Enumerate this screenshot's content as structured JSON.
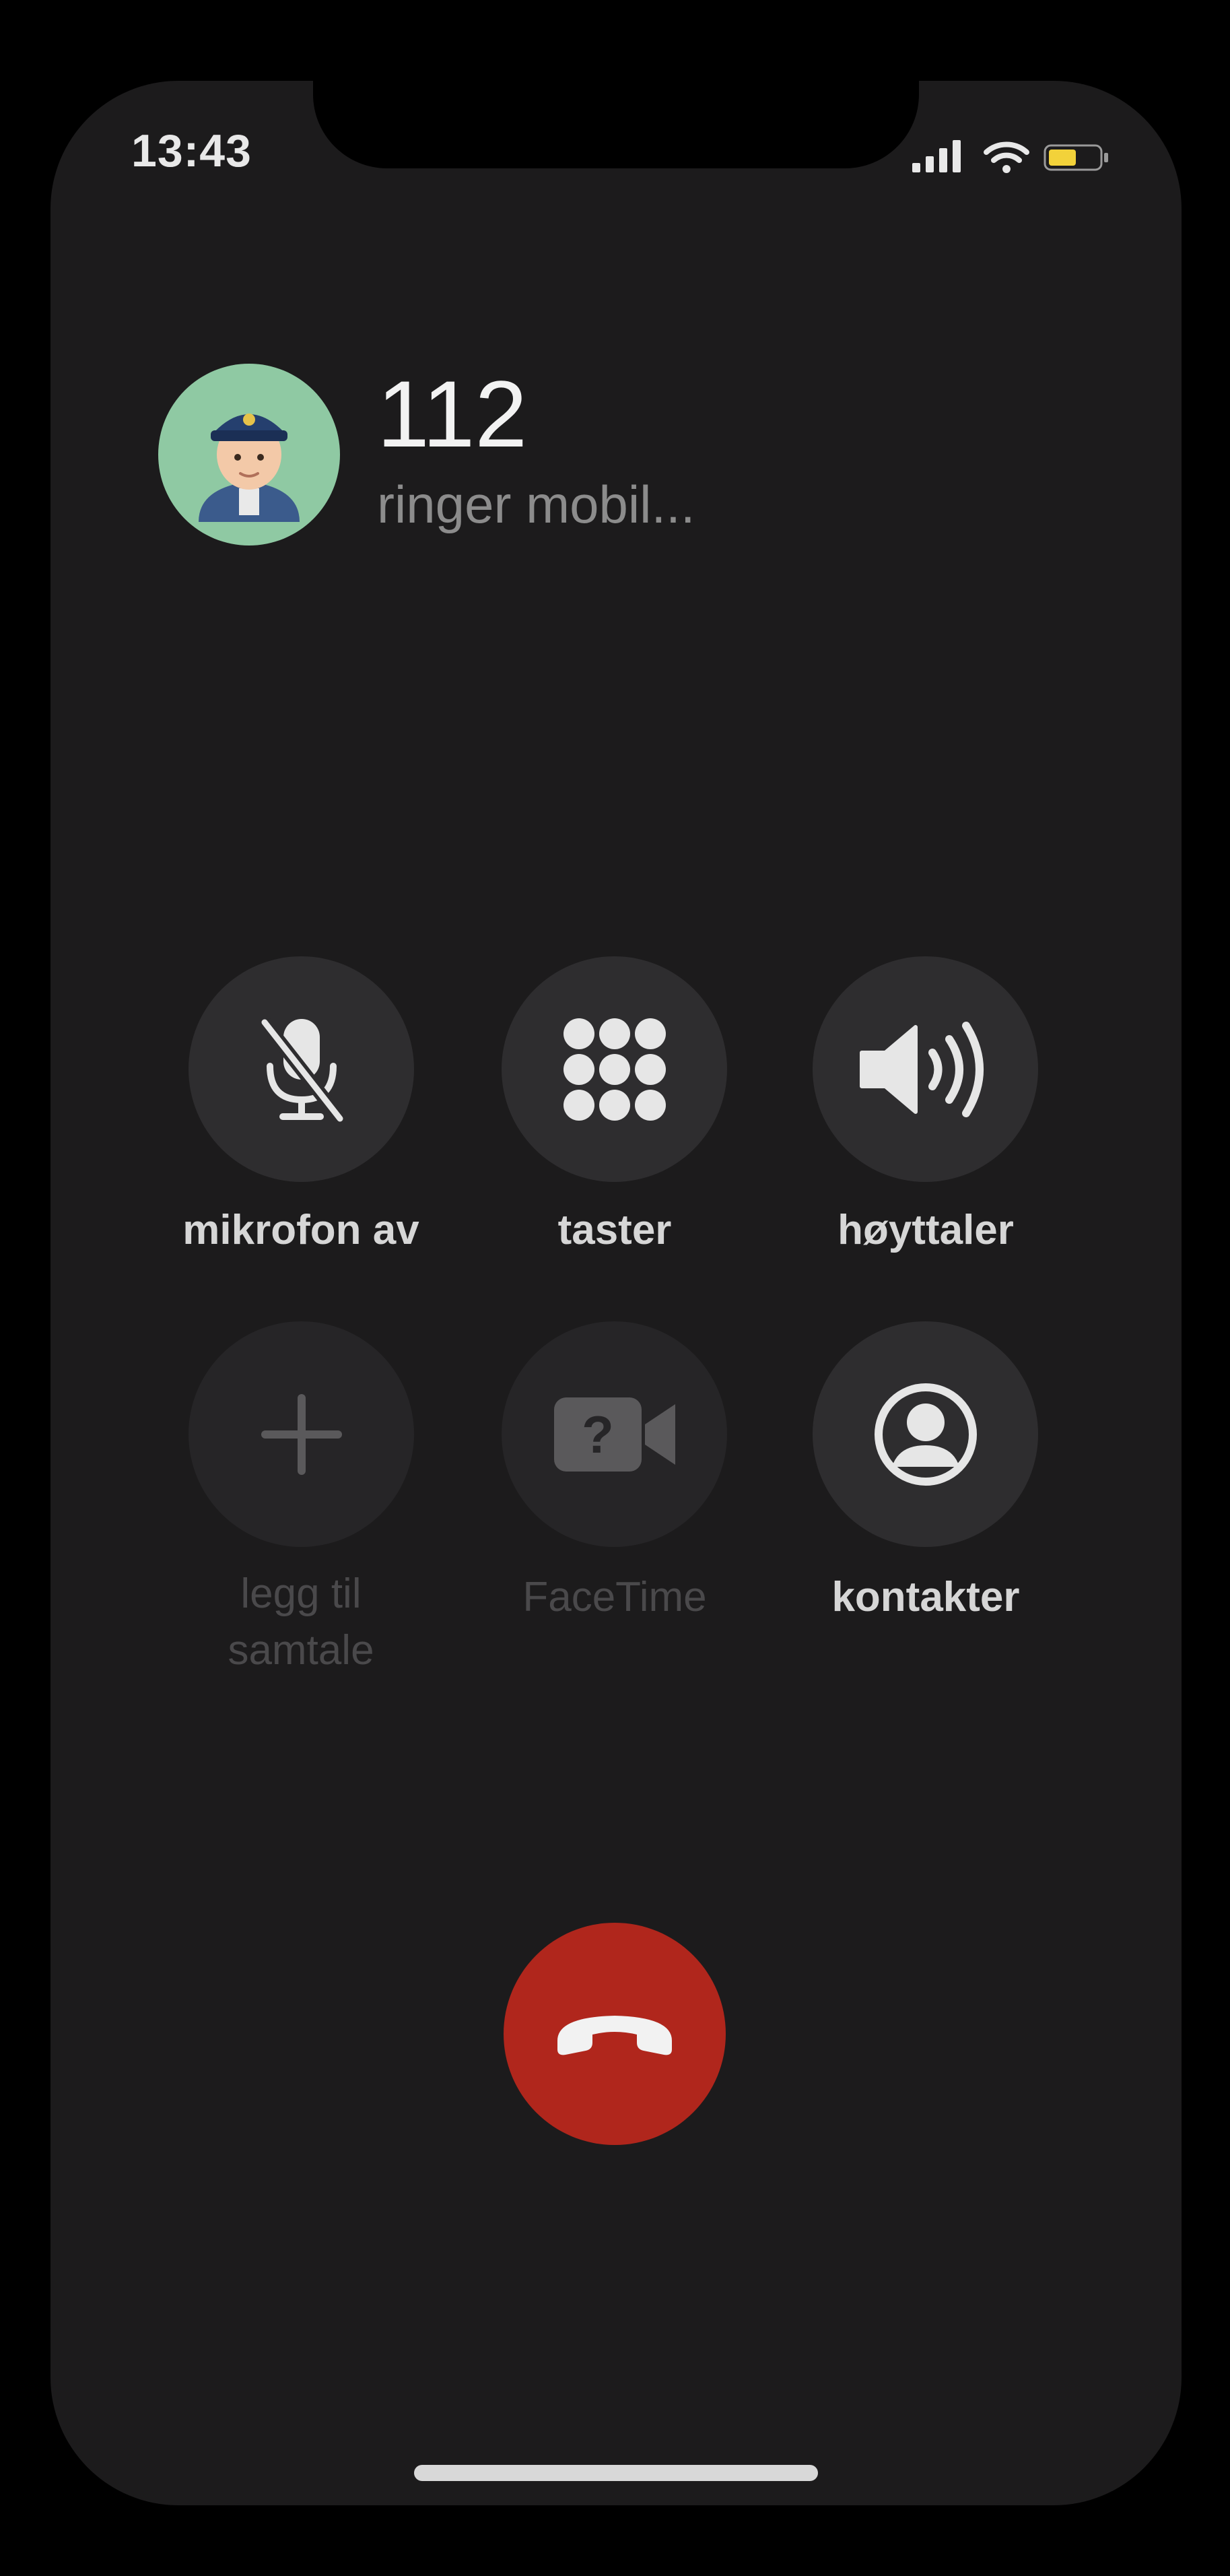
{
  "status_bar": {
    "time": "13:43",
    "icons": [
      "cellular-signal-icon",
      "wifi-icon",
      "battery-icon"
    ],
    "battery_color": "#f2d23a"
  },
  "caller": {
    "avatar_icon": "police-officer-icon",
    "number": "112",
    "status": "ringer mobil..."
  },
  "controls": [
    {
      "label": "mikrofon av",
      "icon": "microphone-slash-icon",
      "enabled": true
    },
    {
      "label": "taster",
      "icon": "keypad-icon",
      "enabled": true
    },
    {
      "label": "høyttaler",
      "icon": "speaker-icon",
      "enabled": true
    },
    {
      "label": "legg til\nsamtale",
      "icon": "plus-icon",
      "enabled": false
    },
    {
      "label": "FaceTime",
      "icon": "facetime-video-icon",
      "enabled": false
    },
    {
      "label": "kontakter",
      "icon": "contact-icon",
      "enabled": true
    }
  ],
  "end_call": {
    "icon": "hang-up-icon",
    "color": "#b0261c"
  },
  "colors": {
    "background": "#1c1b1c",
    "button": "#2e2d2f",
    "avatar": "#8fc9a3"
  }
}
